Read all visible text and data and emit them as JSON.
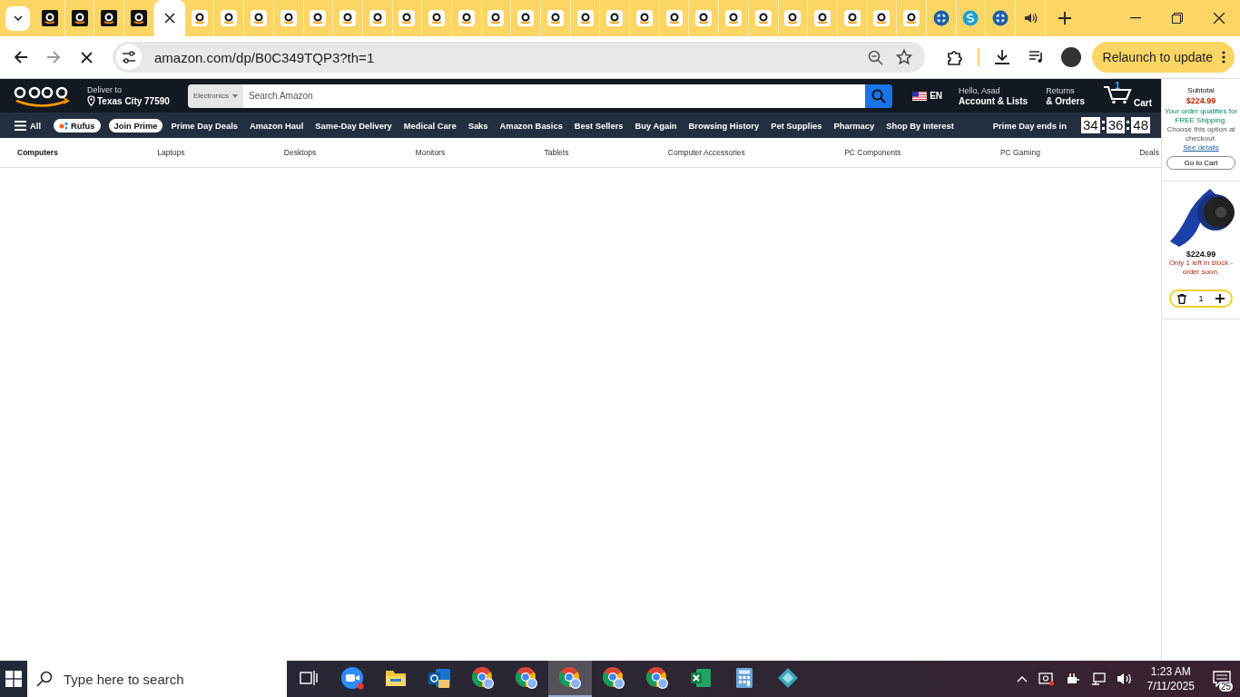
{
  "browser": {
    "tabs": [
      {
        "kind": "dark",
        "selected": false
      },
      {
        "kind": "dark",
        "selected": false
      },
      {
        "kind": "dark",
        "selected": false
      },
      {
        "kind": "dark",
        "selected": false
      },
      {
        "kind": "loading",
        "selected": true
      },
      {
        "kind": "light",
        "selected": false
      },
      {
        "kind": "light",
        "selected": false
      },
      {
        "kind": "light",
        "selected": false
      },
      {
        "kind": "light",
        "selected": false
      },
      {
        "kind": "light",
        "selected": false
      },
      {
        "kind": "light",
        "selected": false
      },
      {
        "kind": "light",
        "selected": false
      },
      {
        "kind": "light",
        "selected": false
      },
      {
        "kind": "light",
        "selected": false
      },
      {
        "kind": "light",
        "selected": false
      },
      {
        "kind": "light",
        "selected": false
      },
      {
        "kind": "light",
        "selected": false
      },
      {
        "kind": "light",
        "selected": false
      },
      {
        "kind": "light",
        "selected": false
      },
      {
        "kind": "light",
        "selected": false
      },
      {
        "kind": "light",
        "selected": false
      },
      {
        "kind": "light",
        "selected": false
      },
      {
        "kind": "light",
        "selected": false
      },
      {
        "kind": "light",
        "selected": false
      },
      {
        "kind": "light",
        "selected": false
      },
      {
        "kind": "light",
        "selected": false
      },
      {
        "kind": "light",
        "selected": false
      },
      {
        "kind": "light",
        "selected": false
      },
      {
        "kind": "light",
        "selected": false
      },
      {
        "kind": "light",
        "selected": false
      },
      {
        "kind": "cross",
        "selected": false
      },
      {
        "kind": "s-circle",
        "selected": false
      },
      {
        "kind": "cross",
        "selected": false
      },
      {
        "kind": "audio",
        "selected": false
      }
    ],
    "address": "amazon.com/dp/B0C349TQP3?th=1",
    "relaunch": "Relaunch to update"
  },
  "header": {
    "deliver_label": "Deliver to",
    "location": "Texas City 77590",
    "search_category": "Electronics",
    "search": {
      "placeholder": "Search Amazon"
    },
    "language": "EN",
    "greeting": "Hello, Asad",
    "account": "Account & Lists",
    "returns": "Returns",
    "orders": "& Orders",
    "cart_count": "1",
    "cart_label": "Cart"
  },
  "nav": {
    "all": "All",
    "rufus": "Rufus",
    "join_prime": "Join Prime",
    "links": [
      "Prime Day Deals",
      "Amazon Haul",
      "Same-Day Delivery",
      "Medical Care",
      "Saks",
      "Amazon Basics",
      "Best Sellers",
      "Buy Again",
      "Browsing History",
      "Pet Supplies",
      "Pharmacy",
      "Shop By Interest"
    ],
    "prime_day": "Prime Day ends in",
    "timer": [
      "34",
      "36",
      "48"
    ]
  },
  "subnav": [
    {
      "label": "Computers",
      "selected": true
    },
    {
      "label": "Laptops",
      "selected": false
    },
    {
      "label": "Desktops",
      "selected": false
    },
    {
      "label": "Monitors",
      "selected": false
    },
    {
      "label": "Tablets",
      "selected": false
    },
    {
      "label": "Computer Accessories",
      "selected": false
    },
    {
      "label": "PC Components",
      "selected": false
    },
    {
      "label": "PC Gaming",
      "selected": false
    },
    {
      "label": "Deals",
      "selected": false
    }
  ],
  "cart_panel": {
    "subtotal_label": "Subtotal",
    "subtotal": "$224.99",
    "shipping": "Your order qualifies for FREE Shipping.",
    "choose": "Choose this option at checkout.",
    "details_link": "See details",
    "go_to_cart": "Go to Cart",
    "item_price": "$224.99",
    "stock": "Only 1 left in stock - order soon.",
    "quantity": "1"
  },
  "taskbar": {
    "search": {
      "placeholder": "Type here to search"
    },
    "apps": [
      {
        "kind": "task-view",
        "selected": false
      },
      {
        "kind": "zoom",
        "selected": false
      },
      {
        "kind": "folder",
        "selected": false
      },
      {
        "kind": "mail",
        "selected": false
      },
      {
        "kind": "chrome",
        "selected": false
      },
      {
        "kind": "chrome",
        "selected": false
      },
      {
        "kind": "chrome",
        "selected": true
      },
      {
        "kind": "chrome",
        "selected": false
      },
      {
        "kind": "chrome",
        "selected": false
      },
      {
        "kind": "excel",
        "selected": false
      },
      {
        "kind": "calculator",
        "selected": false
      },
      {
        "kind": "diamond",
        "selected": false
      }
    ],
    "time": "1:23 AM",
    "date": "7/11/2025",
    "notifications": "25"
  }
}
